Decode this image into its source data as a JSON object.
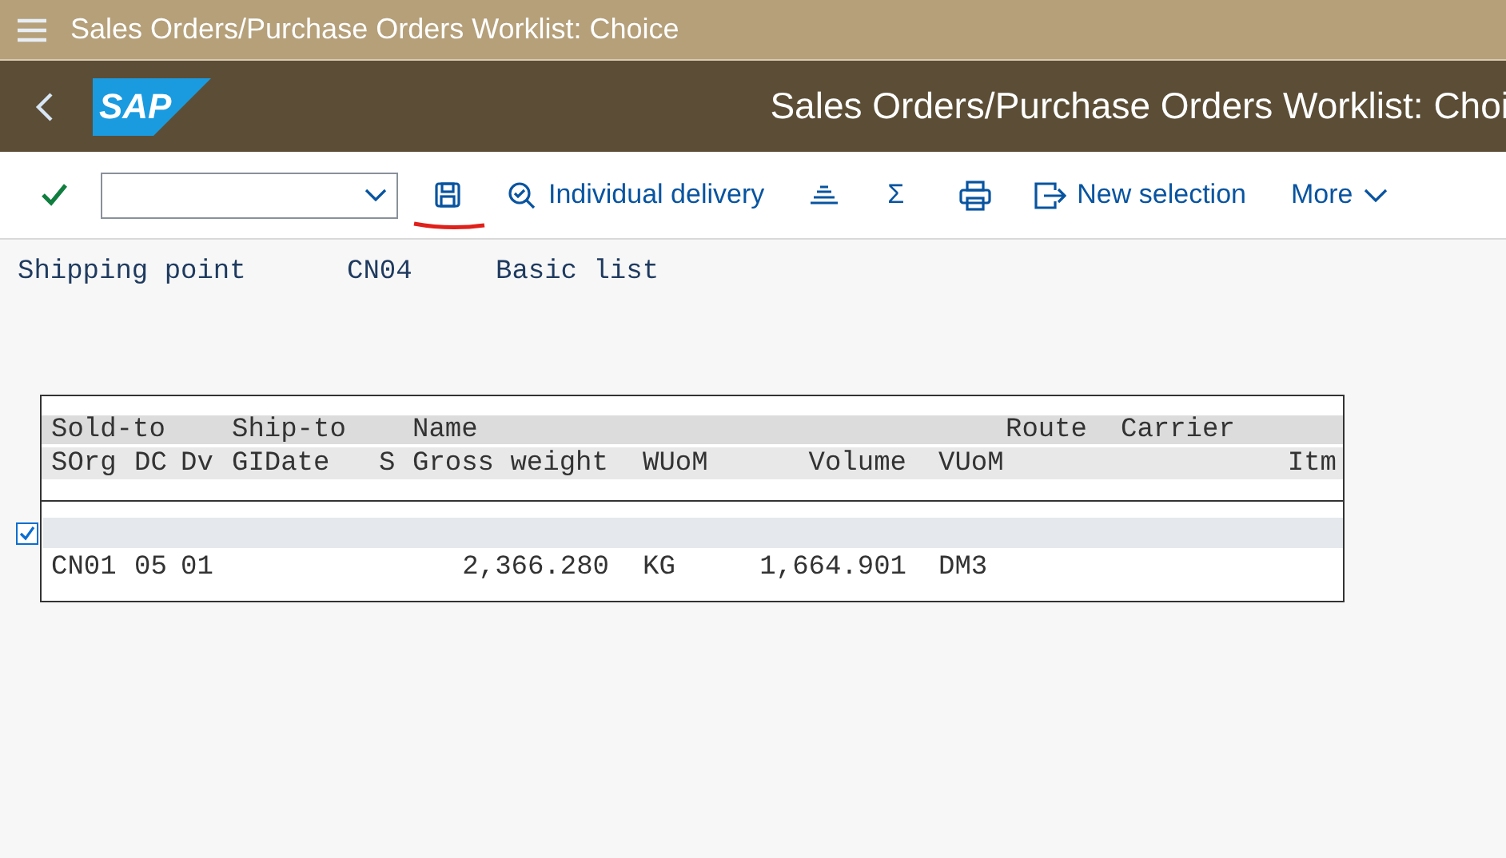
{
  "shell_bar": {
    "title": "Sales Orders/Purchase Orders Worklist: Choice"
  },
  "header": {
    "logo_text": "SAP",
    "title": "Sales Orders/Purchase Orders Worklist: Choi"
  },
  "toolbar": [
    {
      "kind": "confirm"
    },
    {
      "kind": "select"
    },
    {
      "kind": "save"
    },
    {
      "kind": "details",
      "label": "Individual delivery"
    },
    {
      "kind": "sort"
    },
    {
      "kind": "sum",
      "label": "Σ"
    },
    {
      "kind": "print"
    },
    {
      "kind": "new_selection",
      "label": "New selection"
    },
    {
      "kind": "more",
      "label": "More"
    }
  ],
  "info_line": {
    "label": "Shipping point",
    "value": "CN04",
    "list_type": "Basic list"
  },
  "list": {
    "header_line_1": {
      "sold_to": "Sold-to",
      "ship_to": "Ship-to",
      "name": "Name",
      "route": "Route",
      "carrier": "Carrier"
    },
    "header_line_2": {
      "sorg": "SOrg",
      "dc": "DC",
      "dv": "Dv",
      "gi_date": "GIDate",
      "s": "S",
      "gross_weight": "Gross weight",
      "wuom": "WUoM",
      "volume": "Volume",
      "vuom": "VUoM",
      "itm": "Itm"
    },
    "entries": [
      {
        "checked": true,
        "detail": {
          "sorg": "CN01",
          "dc": "05",
          "dv": "01",
          "gross_weight": "2,366.280",
          "wuom": "KG",
          "volume": "1,664.901",
          "vuom": "DM3"
        }
      }
    ]
  }
}
